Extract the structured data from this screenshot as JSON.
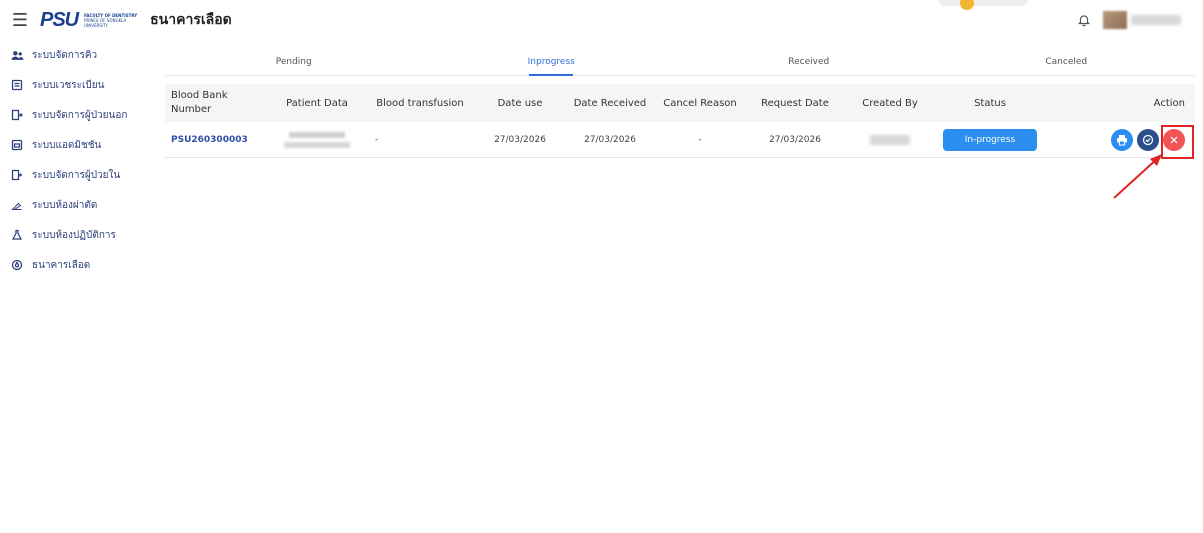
{
  "header": {
    "logo_text": "PSU",
    "logo_sub_line1": "FACULTY OF DENTISTRY",
    "logo_sub_line2": "PRINCE OF SONGKLA UNIVERSITY",
    "page_title": "ธนาคารเลือด"
  },
  "sidebar": {
    "items": [
      {
        "label": "ระบบจัดการคิว",
        "icon": "users-icon"
      },
      {
        "label": "ระบบเวชระเบียน",
        "icon": "document-icon"
      },
      {
        "label": "ระบบจัดการผู้ป่วยนอก",
        "icon": "outpatient-icon"
      },
      {
        "label": "ระบบแอดมิชชัน",
        "icon": "admission-icon"
      },
      {
        "label": "ระบบจัดการผู้ป่วยใน",
        "icon": "inpatient-icon"
      },
      {
        "label": "ระบบห้องผ่าตัด",
        "icon": "scalpel-icon"
      },
      {
        "label": "ระบบห้องปฏิบัติการ",
        "icon": "flask-icon"
      },
      {
        "label": "ธนาคารเลือด",
        "icon": "blood-drop-icon"
      }
    ]
  },
  "tabs": [
    {
      "label": "Pending",
      "active": false
    },
    {
      "label": "Inprogress",
      "active": true
    },
    {
      "label": "Received",
      "active": false
    },
    {
      "label": "Canceled",
      "active": false
    }
  ],
  "table": {
    "columns": [
      "Blood Bank Number",
      "Patient Data",
      "Blood transfusion",
      "Date use",
      "Date Received",
      "Cancel Reason",
      "Request Date",
      "Created By",
      "Status",
      "Action"
    ],
    "rows": [
      {
        "blood_bank_number": "PSU260300003",
        "blood_transfusion": "-",
        "date_use": "27/03/2026",
        "date_received": "27/03/2026",
        "cancel_reason": "-",
        "request_date": "27/03/2026",
        "status": "In-progress"
      }
    ]
  },
  "colors": {
    "accent": "#2f6fd6",
    "status_button": "#2b8ef0",
    "cancel_action": "#f05454",
    "approve_action": "#2c4f8c",
    "highlight": "#e02424"
  }
}
